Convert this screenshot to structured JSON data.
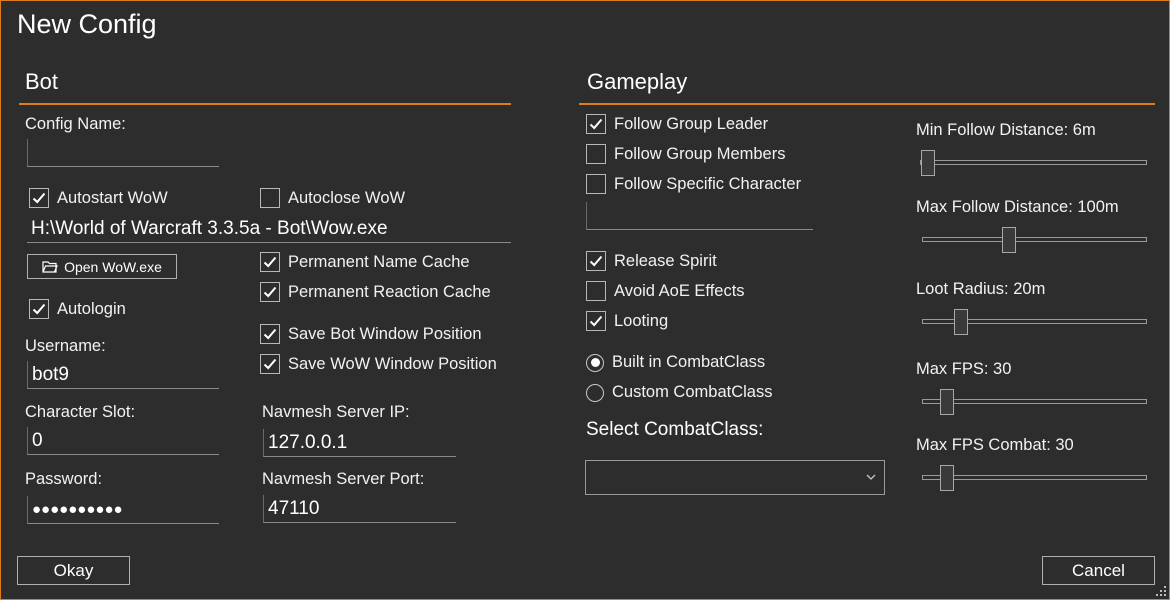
{
  "window": {
    "title": "New Config"
  },
  "bot": {
    "section_title": "Bot",
    "config_name": {
      "label": "Config Name:",
      "value": ""
    },
    "autostart": {
      "label": "Autostart WoW",
      "checked": true
    },
    "autoclose": {
      "label": "Autoclose WoW",
      "checked": false
    },
    "wow_path": "H:\\World of Warcraft 3.3.5a - Bot\\Wow.exe",
    "open_wow_button": {
      "label": "Open WoW.exe",
      "icon": "folder-icon"
    },
    "permanent_name_cache": {
      "label": "Permanent Name Cache",
      "checked": true
    },
    "permanent_reaction_cache": {
      "label": "Permanent Reaction Cache",
      "checked": true
    },
    "autologin": {
      "label": "Autologin",
      "checked": true
    },
    "save_bot_window_pos": {
      "label": "Save Bot Window Position",
      "checked": true
    },
    "save_wow_window_pos": {
      "label": "Save WoW Window Position",
      "checked": true
    },
    "username": {
      "label": "Username:",
      "value": "bot9"
    },
    "character_slot": {
      "label": "Character Slot:",
      "value": "0"
    },
    "password": {
      "label": "Password:",
      "value": "●●●●●●●●●●"
    },
    "navmesh_ip": {
      "label": "Navmesh Server IP:",
      "value": "127.0.0.1"
    },
    "navmesh_port": {
      "label": "Navmesh Server Port:",
      "value": "47110"
    }
  },
  "gameplay": {
    "section_title": "Gameplay",
    "follow_group_leader": {
      "label": "Follow Group Leader",
      "checked": true
    },
    "follow_group_members": {
      "label": "Follow Group Members",
      "checked": false
    },
    "follow_specific_character": {
      "label": "Follow Specific Character",
      "checked": false
    },
    "specific_character_name": "",
    "release_spirit": {
      "label": "Release Spirit",
      "checked": true
    },
    "avoid_aoe": {
      "label": "Avoid AoE Effects",
      "checked": false
    },
    "looting": {
      "label": "Looting",
      "checked": true
    },
    "builtin_combatclass": {
      "label": "Built in CombatClass",
      "selected": true
    },
    "custom_combatclass": {
      "label": "Custom CombatClass",
      "selected": false
    },
    "select_combatclass_label": "Select CombatClass:",
    "select_combatclass_value": "",
    "sliders": [
      {
        "label": "Min Follow Distance: 6m",
        "fraction": 0.0
      },
      {
        "label": "Max Follow Distance: 100m",
        "fraction": 0.38
      },
      {
        "label": "Loot Radius: 20m",
        "fraction": 0.15
      },
      {
        "label": "Max FPS: 30",
        "fraction": 0.08
      },
      {
        "label": "Max FPS Combat: 30",
        "fraction": 0.08
      }
    ]
  },
  "footer": {
    "okay_label": "Okay",
    "cancel_label": "Cancel"
  },
  "colors": {
    "accent": "#e07b1a",
    "background": "#2d2d2d",
    "text": "#ffffff"
  }
}
